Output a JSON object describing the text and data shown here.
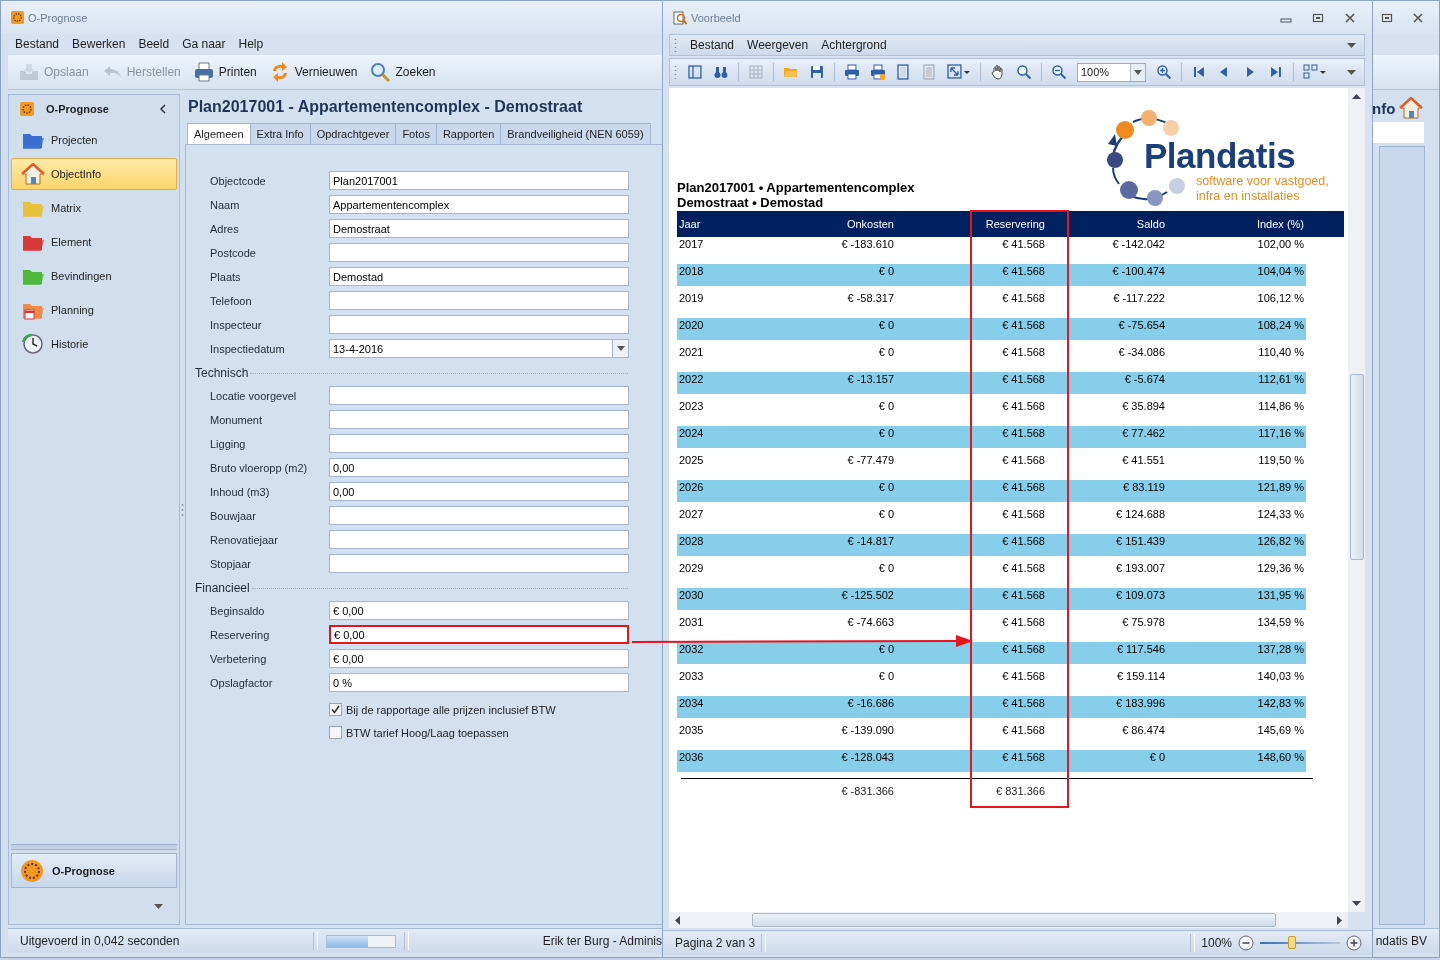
{
  "main_window": {
    "title": "O-Prognose",
    "menu": [
      "Bestand",
      "Bewerken",
      "Beeld",
      "Ga naar",
      "Help"
    ],
    "toolbar": [
      {
        "label": "Opslaan",
        "disabled": true
      },
      {
        "label": "Herstellen",
        "disabled": true
      },
      {
        "label": "Printen",
        "disabled": false
      },
      {
        "label": "Vernieuwen",
        "disabled": false
      },
      {
        "label": "Zoeken",
        "disabled": false
      }
    ],
    "sidebar": {
      "title": "O-Prognose",
      "items": [
        {
          "label": "Projecten",
          "selected": false
        },
        {
          "label": "ObjectInfo",
          "selected": true
        },
        {
          "label": "Matrix",
          "selected": false
        },
        {
          "label": "Element",
          "selected": false
        },
        {
          "label": "Bevindingen",
          "selected": false
        },
        {
          "label": "Planning",
          "selected": false
        },
        {
          "label": "Historie",
          "selected": false
        }
      ],
      "footer_button": "O-Prognose"
    },
    "header": "Plan2017001 - Appartementencomplex - Demostraat",
    "tabs": [
      {
        "label": "Algemeen",
        "selected": true
      },
      {
        "label": "Extra Info",
        "selected": false
      },
      {
        "label": "Opdrachtgever",
        "selected": false
      },
      {
        "label": "Fotos",
        "selected": false
      },
      {
        "label": "Rapporten",
        "selected": false
      },
      {
        "label": "Brandveiligheid (NEN 6059)",
        "selected": false
      }
    ],
    "sections": [
      {
        "fields": [
          {
            "label": "Objectcode",
            "value": "Plan2017001",
            "kind": "text",
            "highlighted": false
          },
          {
            "label": "Naam",
            "value": "Appartementencomplex",
            "kind": "text",
            "highlighted": false
          },
          {
            "label": "Adres",
            "value": "Demostraat",
            "kind": "text",
            "highlighted": false
          },
          {
            "label": "Postcode",
            "kind": "text",
            "highlighted": false
          },
          {
            "label": "Plaats",
            "value": "Demostad",
            "kind": "text",
            "highlighted": false
          },
          {
            "label": "Telefoon",
            "kind": "text",
            "highlighted": false
          },
          {
            "label": "Inspecteur",
            "kind": "text",
            "highlighted": false
          },
          {
            "label": "Inspectiedatum",
            "value": "13-4-2016",
            "kind": "date",
            "highlighted": false
          }
        ]
      },
      {
        "title": "Technisch",
        "fields": [
          {
            "label": "Locatie voorgevel",
            "kind": "text",
            "highlighted": false
          },
          {
            "label": "Monument",
            "kind": "text",
            "highlighted": false
          },
          {
            "label": "Ligging",
            "kind": "text",
            "highlighted": false
          },
          {
            "label": "Bruto vloeropp (m2)",
            "value": "0,00",
            "kind": "text",
            "highlighted": false
          },
          {
            "label": "Inhoud (m3)",
            "value": "0,00",
            "kind": "text",
            "highlighted": false
          },
          {
            "label": "Bouwjaar",
            "kind": "text",
            "highlighted": false
          },
          {
            "label": "Renovatiejaar",
            "kind": "text",
            "highlighted": false
          },
          {
            "label": "Stopjaar",
            "kind": "text",
            "highlighted": false
          }
        ]
      },
      {
        "title": "Financieel",
        "fields": [
          {
            "label": "Beginsaldo",
            "value": "€ 0,00",
            "kind": "text",
            "highlighted": false
          },
          {
            "label": "Reservering",
            "value": "€ 0,00",
            "kind": "text",
            "highlighted": true
          },
          {
            "label": "Verbetering",
            "value": "€ 0,00",
            "kind": "text",
            "highlighted": false
          },
          {
            "label": "Opslagfactor",
            "value": "0 %",
            "kind": "text",
            "highlighted": false
          }
        ]
      }
    ],
    "checkboxes": [
      {
        "label": "Bij de rapportage alle prijzen inclusief BTW",
        "checked": true
      },
      {
        "label": "BTW tarief Hoog/Laag toepassen",
        "checked": false
      }
    ],
    "status_bar": {
      "message": "Uitgevoerd in 0,042 seconden",
      "progress": {
        "level": 0.6
      },
      "user": "Erik ter Burg - Adminis",
      "right_text": "ndatis BV"
    },
    "side_panel": {
      "title": "nfo"
    }
  },
  "preview_window": {
    "title": "Voorbeeld",
    "menu": [
      "Bestand",
      "Weergeven",
      "Achtergrond"
    ],
    "zoom_box": "100%",
    "report": {
      "logo": {
        "name": "Plandatis",
        "tagline": [
          "software voor vastgoed,",
          "infra en installaties"
        ]
      },
      "title_lines": [
        "Plan2017001 • Appartementencomplex",
        "Demostraat • Demostad"
      ],
      "columns": [
        {
          "label": "Jaar",
          "highlighted": false
        },
        {
          "label": "Onkosten",
          "highlighted": false
        },
        {
          "label": "Reservering",
          "highlighted": true
        },
        {
          "label": "Saldo",
          "highlighted": false
        },
        {
          "label": "Index (%)",
          "highlighted": false
        }
      ],
      "rows": [
        [
          "2017",
          "€ -183.610",
          "€ 41.568",
          "€ -142.042",
          "102,00 %"
        ],
        [
          "2018",
          "€ 0",
          "€ 41.568",
          "€ -100.474",
          "104,04 %"
        ],
        [
          "2019",
          "€ -58.317",
          "€ 41.568",
          "€ -117.222",
          "106,12 %"
        ],
        [
          "2020",
          "€ 0",
          "€ 41.568",
          "€ -75.654",
          "108,24 %"
        ],
        [
          "2021",
          "€ 0",
          "€ 41.568",
          "€ -34.086",
          "110,40 %"
        ],
        [
          "2022",
          "€ -13.157",
          "€ 41.568",
          "€ -5.674",
          "112,61 %"
        ],
        [
          "2023",
          "€ 0",
          "€ 41.568",
          "€ 35.894",
          "114,86 %"
        ],
        [
          "2024",
          "€ 0",
          "€ 41.568",
          "€ 77.462",
          "117,16 %"
        ],
        [
          "2025",
          "€ -77.479",
          "€ 41.568",
          "€ 41.551",
          "119,50 %"
        ],
        [
          "2026",
          "€ 0",
          "€ 41.568",
          "€ 83.119",
          "121,89 %"
        ],
        [
          "2027",
          "€ 0",
          "€ 41.568",
          "€ 124.688",
          "124,33 %"
        ],
        [
          "2028",
          "€ -14.817",
          "€ 41.568",
          "€ 151.439",
          "126,82 %"
        ],
        [
          "2029",
          "€ 0",
          "€ 41.568",
          "€ 193.007",
          "129,36 %"
        ],
        [
          "2030",
          "€ -125.502",
          "€ 41.568",
          "€ 109.073",
          "131,95 %"
        ],
        [
          "2031",
          "€ -74.663",
          "€ 41.568",
          "€ 75.978",
          "134,59 %"
        ],
        [
          "2032",
          "€ 0",
          "€ 41.568",
          "€ 117.546",
          "137,28 %"
        ],
        [
          "2033",
          "€ 0",
          "€ 41.568",
          "€ 159.114",
          "140,03 %"
        ],
        [
          "2034",
          "€ -16.686",
          "€ 41.568",
          "€ 183.996",
          "142,83 %"
        ],
        [
          "2035",
          "€ -139.090",
          "€ 41.568",
          "€ 86.474",
          "145,69 %"
        ],
        [
          "2036",
          "€ -128.043",
          "€ 41.568",
          "€ 0",
          "148,60 %"
        ]
      ],
      "totals": [
        "€ -831.366",
        "€ 831.366"
      ]
    },
    "status_bar": {
      "page": "Pagina 2 van 3",
      "zoom": "100%",
      "zoom_slider": {
        "level": 0.4
      }
    }
  }
}
